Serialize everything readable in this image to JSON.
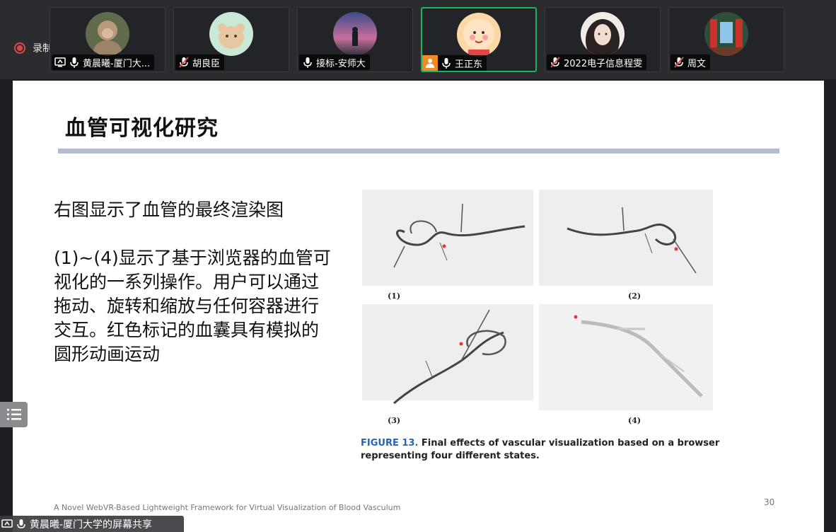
{
  "recording": {
    "label": "录制中"
  },
  "participants": [
    {
      "name": "黄晨曦-厦门大...",
      "avatar": "monkey-photo",
      "mic": "on",
      "sharing": true
    },
    {
      "name": "胡良臣",
      "avatar": "cartoon-bear",
      "mic": "muted"
    },
    {
      "name": "接标-安师大",
      "avatar": "sunset-photo",
      "mic": "on"
    },
    {
      "name": "王正东",
      "avatar": "cartoon-baby",
      "mic": "on",
      "active": true,
      "badge": "person-icon"
    },
    {
      "name": "2022电子信息程雯",
      "avatar": "girl-illustration",
      "mic": "muted"
    },
    {
      "name": "周文",
      "avatar": "room-photo",
      "mic": "muted"
    }
  ],
  "slide": {
    "title": "血管可视化研究",
    "paragraph1": "右图显示了血管的最终渲染图",
    "paragraph2": "(1)~(4)显示了基于浏览器的血管可视化的一系列操作。用户可以通过拖动、旋转和缩放与任何容器进行交互。红色标记的血囊具有模拟的圆形动画运动",
    "figure": {
      "panel_labels": [
        "(1)",
        "(2)",
        "(3)",
        "(4)"
      ],
      "caption_prefix": "FIGURE 13.",
      "caption_text": " Final effects of vascular visualization based on a browser representing four different states."
    },
    "footer": "A Novel WebVR-Based Lightweight Framework for Virtual Visualization of Blood Vasculum",
    "page_number": "30"
  },
  "share_label": "黄晨曦-厦门大学的屏幕共享",
  "colors": {
    "accent_green": "#22b35a",
    "record_red": "#e04848",
    "caption_blue": "#2a63b0",
    "rule": "#b4bccd"
  }
}
